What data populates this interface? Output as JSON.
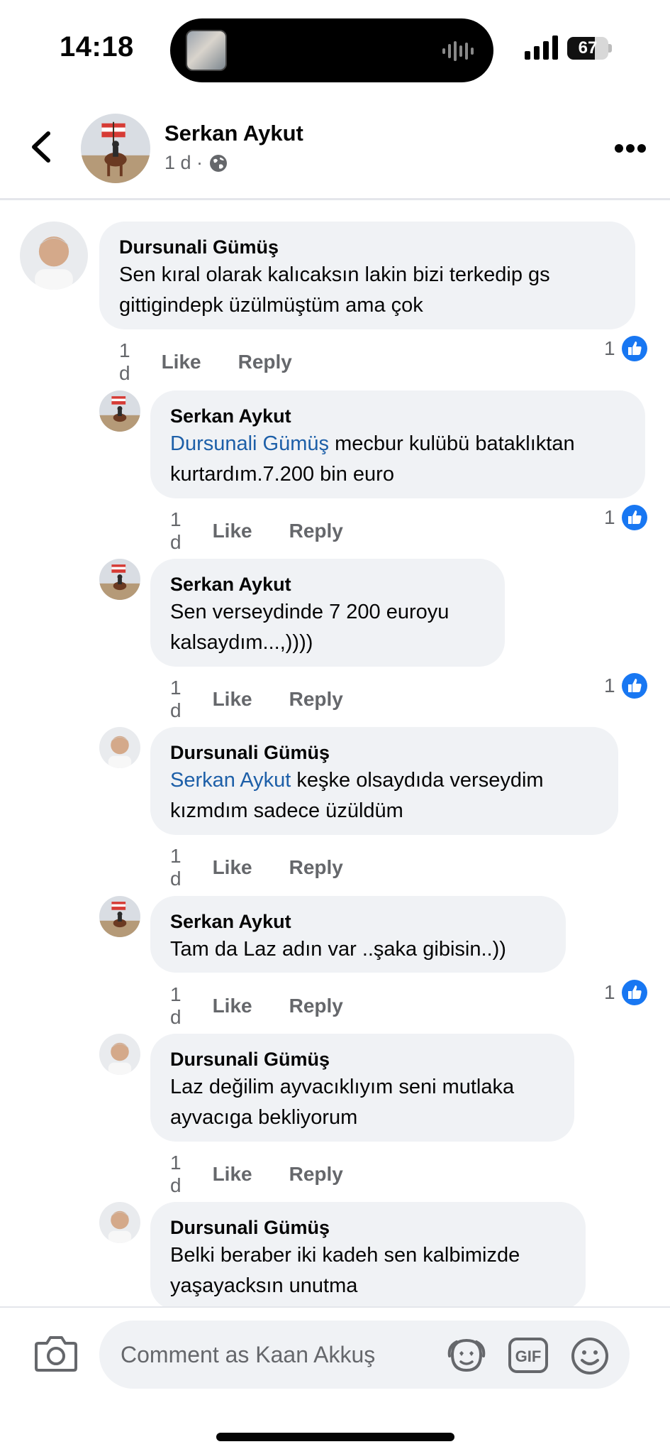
{
  "status_bar": {
    "time": "14:18",
    "battery_percent": 67,
    "battery_label": "67"
  },
  "header": {
    "name": "Serkan Aykut",
    "meta": "1 d ·"
  },
  "comments": [
    {
      "author": "Dursunali Gümüş",
      "mention": "",
      "text": "Sen   kıral olarak kalıcaksın lakin bizi terkedip gs gittigindepk üzülmüştüm ama çok",
      "age": "1 d",
      "like": "Like",
      "reply": "Reply",
      "reactions": "1"
    },
    {
      "author": "Serkan Aykut",
      "mention": "Dursunali Gümüş",
      "text": " mecbur kulübü bataklıktan kurtardım.7.200 bin euro",
      "age": "1 d",
      "like": "Like",
      "reply": "Reply",
      "reactions": "1"
    },
    {
      "author": "Serkan Aykut",
      "mention": "",
      "text": "Sen verseydinde 7 200 euroyu kalsaydım...,))))",
      "age": "1 d",
      "like": "Like",
      "reply": "Reply",
      "reactions": "1"
    },
    {
      "author": "Dursunali Gümüş",
      "mention": "Serkan Aykut",
      "text": " keşke olsaydıda   verseydim kızmdım sadece üzüldüm",
      "age": "1 d",
      "like": "Like",
      "reply": "Reply",
      "reactions": ""
    },
    {
      "author": "Serkan Aykut",
      "mention": "",
      "text": "Tam da Laz adın var ..şaka gibisin..))",
      "age": "1 d",
      "like": "Like",
      "reply": "Reply",
      "reactions": "1"
    },
    {
      "author": "Dursunali Gümüş",
      "mention": "",
      "text": "Laz değilim ayvacıklıyım seni mutlaka ayvacıga bekliyorum",
      "age": "1 d",
      "like": "Like",
      "reply": "Reply",
      "reactions": ""
    },
    {
      "author": "Dursunali Gümüş",
      "mention": "",
      "text": "Belki beraber iki kadeh sen kalbimizde yaşayacksın unutma",
      "age": "",
      "like": "",
      "reply": "",
      "reactions": ""
    }
  ],
  "composer": {
    "placeholder": "Comment as Kaan Akkuş",
    "gif_label": "GIF"
  },
  "colors": {
    "mention": "#1d5fa8",
    "like_blue": "#1877f2",
    "bubble": "#f0f2f5",
    "secondary_text": "#65676b"
  },
  "icons": [
    "back-icon",
    "globe-icon",
    "more-icon",
    "like-icon",
    "camera-icon",
    "avatar-sticker-icon",
    "gif-icon",
    "emoji-icon"
  ]
}
